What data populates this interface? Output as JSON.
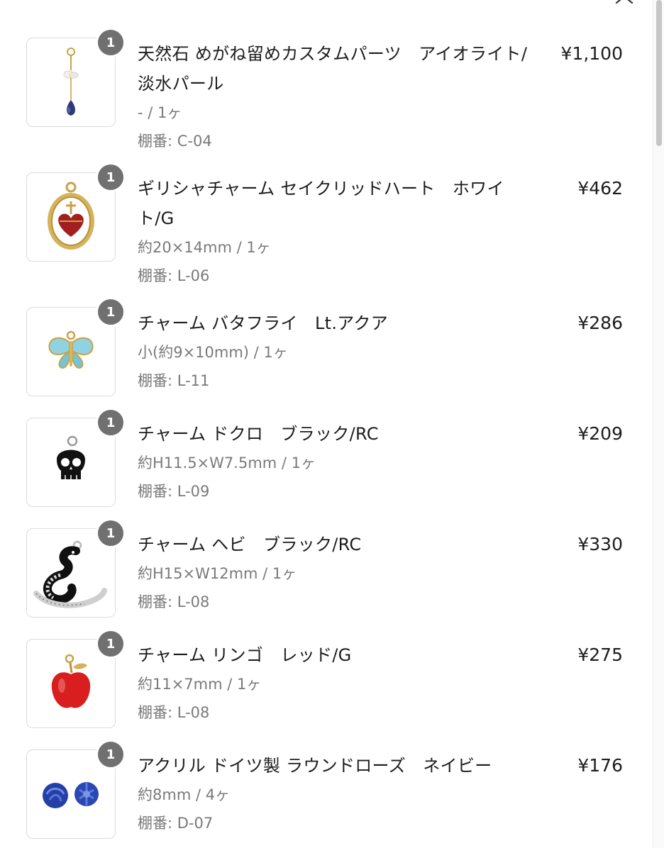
{
  "header": {
    "close_icon": "close-icon"
  },
  "cart": {
    "items": [
      {
        "qty": "1",
        "name": "天然石 めがね留めカスタムパーツ　アイオライト/淡水パール",
        "spec": "- / 1ヶ",
        "shelf": "棚番: C-04",
        "price": "¥1,100",
        "icon": "iolite-pearl-drop-charm-icon"
      },
      {
        "qty": "1",
        "name": "ギリシャチャーム セイクリッドハート　ホワイト/G",
        "spec": "約20×14mm / 1ヶ",
        "shelf": "棚番: L-06",
        "price": "¥462",
        "icon": "sacred-heart-charm-icon"
      },
      {
        "qty": "1",
        "name": "チャーム バタフライ　Lt.アクア",
        "spec": "小(約9×10mm) / 1ヶ",
        "shelf": "棚番: L-11",
        "price": "¥286",
        "icon": "butterfly-charm-icon"
      },
      {
        "qty": "1",
        "name": "チャーム ドクロ　ブラック/RC",
        "spec": "約H11.5×W7.5mm / 1ヶ",
        "shelf": "棚番: L-09",
        "price": "¥209",
        "icon": "skull-charm-icon"
      },
      {
        "qty": "1",
        "name": "チャーム ヘビ　ブラック/RC",
        "spec": "約H15×W12mm / 1ヶ",
        "shelf": "棚番: L-08",
        "price": "¥330",
        "icon": "snake-charm-icon"
      },
      {
        "qty": "1",
        "name": "チャーム リンゴ　レッド/G",
        "spec": "約11×7mm / 1ヶ",
        "shelf": "棚番: L-08",
        "price": "¥275",
        "icon": "apple-charm-icon"
      },
      {
        "qty": "1",
        "name": "アクリル ドイツ製 ラウンドローズ　ネイビー",
        "spec": "約8mm / 4ヶ",
        "shelf": "棚番: D-07",
        "price": "¥176",
        "icon": "navy-rose-beads-icon"
      }
    ]
  },
  "colors": {
    "badge": "#707070",
    "text": "#1c1c1c",
    "muted": "#7a7a7a",
    "border": "#dcdcdc"
  }
}
